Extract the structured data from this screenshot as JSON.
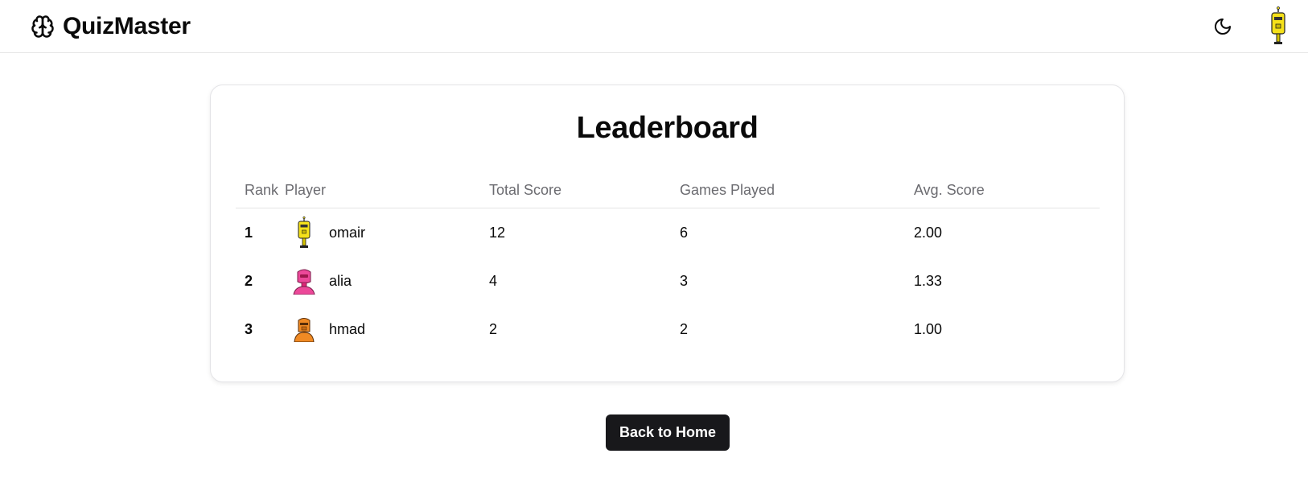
{
  "header": {
    "brand_name": "QuizMaster",
    "brand_icon": "brain-icon",
    "theme_icon": "moon-icon"
  },
  "leaderboard": {
    "title": "Leaderboard",
    "columns": [
      "Rank",
      "Player",
      "Total Score",
      "Games Played",
      "Avg. Score"
    ],
    "rows": [
      {
        "rank": "1",
        "player": "omair",
        "total_score": "12",
        "games_played": "6",
        "avg_score": "2.00",
        "avatar_color": "#f5e11a"
      },
      {
        "rank": "2",
        "player": "alia",
        "total_score": "4",
        "games_played": "3",
        "avg_score": "1.33",
        "avatar_color": "#ec4899"
      },
      {
        "rank": "3",
        "player": "hmad",
        "total_score": "2",
        "games_played": "2",
        "avg_score": "1.00",
        "avatar_color": "#f08a24"
      }
    ]
  },
  "actions": {
    "back_label": "Back to Home"
  },
  "colors": {
    "primary_button": "#18181b",
    "border": "#e5e5e5",
    "muted_text": "#6b6b70"
  }
}
